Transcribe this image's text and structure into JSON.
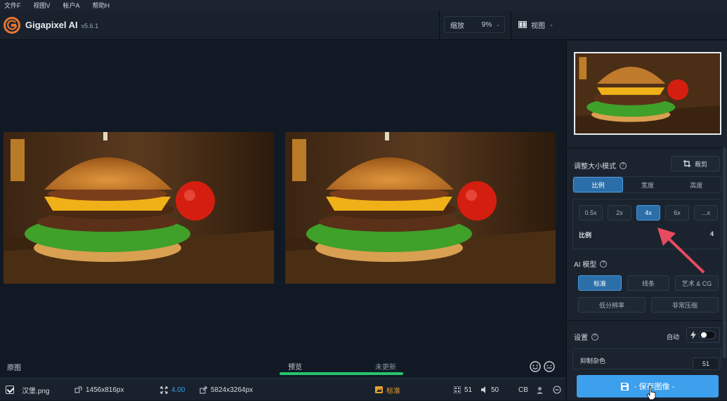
{
  "menu": {
    "items": [
      "文件F",
      "视图V",
      "帐户A",
      "帮助H"
    ]
  },
  "app": {
    "name": "Gigapixel AI",
    "version": "v5.6.1"
  },
  "toolbar": {
    "zoom_label": "缩放",
    "zoom_value": "9%",
    "view_label": "视图"
  },
  "canvas": {
    "original_label": "原图",
    "preview_tab": "预览",
    "not_updated_tab": "未更新"
  },
  "status": {
    "filename": "汉堡.png",
    "input_size": "1456x816px",
    "scale": "4.00",
    "output_size": "5824x3264px",
    "model": "标准",
    "v1": "51",
    "v2": "50",
    "cb": "CB"
  },
  "panel": {
    "resize_title": "调整大小模式",
    "crop_label": "裁剪",
    "mode_tabs": [
      "比例",
      "宽度",
      "高度"
    ],
    "scale_options": [
      "0.5x",
      "2x",
      "4x",
      "6x",
      "...x"
    ],
    "scale_label": "比例",
    "scale_value": "4",
    "ai_model_title": "AI 模型",
    "models_row1": [
      "标准",
      "线条",
      "艺术 & CG"
    ],
    "models_row2": [
      "低分辨率",
      "非常压缩"
    ],
    "settings_title": "设置",
    "auto_label": "自动",
    "denoise_label": "抑制杂色",
    "denoise_value": "51",
    "save_label": "- 保存图像 -"
  },
  "colors": {
    "accent": "#3da0ec",
    "progress": "#27c46b",
    "arrow": "#e84a5f"
  }
}
